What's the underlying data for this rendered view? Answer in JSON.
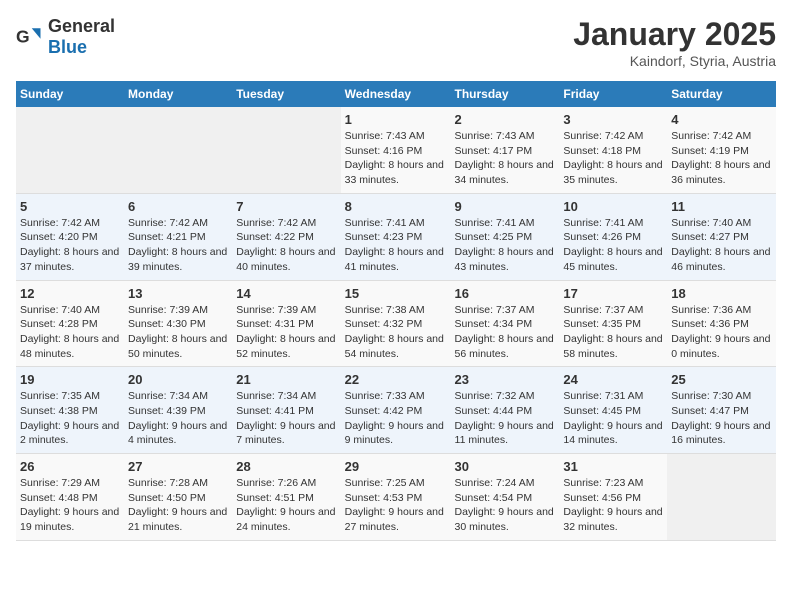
{
  "header": {
    "logo_general": "General",
    "logo_blue": "Blue",
    "title": "January 2025",
    "subtitle": "Kaindorf, Styria, Austria"
  },
  "weekdays": [
    "Sunday",
    "Monday",
    "Tuesday",
    "Wednesday",
    "Thursday",
    "Friday",
    "Saturday"
  ],
  "weeks": [
    [
      {
        "day": "",
        "info": ""
      },
      {
        "day": "",
        "info": ""
      },
      {
        "day": "",
        "info": ""
      },
      {
        "day": "1",
        "info": "Sunrise: 7:43 AM\nSunset: 4:16 PM\nDaylight: 8 hours and 33 minutes."
      },
      {
        "day": "2",
        "info": "Sunrise: 7:43 AM\nSunset: 4:17 PM\nDaylight: 8 hours and 34 minutes."
      },
      {
        "day": "3",
        "info": "Sunrise: 7:42 AM\nSunset: 4:18 PM\nDaylight: 8 hours and 35 minutes."
      },
      {
        "day": "4",
        "info": "Sunrise: 7:42 AM\nSunset: 4:19 PM\nDaylight: 8 hours and 36 minutes."
      }
    ],
    [
      {
        "day": "5",
        "info": "Sunrise: 7:42 AM\nSunset: 4:20 PM\nDaylight: 8 hours and 37 minutes."
      },
      {
        "day": "6",
        "info": "Sunrise: 7:42 AM\nSunset: 4:21 PM\nDaylight: 8 hours and 39 minutes."
      },
      {
        "day": "7",
        "info": "Sunrise: 7:42 AM\nSunset: 4:22 PM\nDaylight: 8 hours and 40 minutes."
      },
      {
        "day": "8",
        "info": "Sunrise: 7:41 AM\nSunset: 4:23 PM\nDaylight: 8 hours and 41 minutes."
      },
      {
        "day": "9",
        "info": "Sunrise: 7:41 AM\nSunset: 4:25 PM\nDaylight: 8 hours and 43 minutes."
      },
      {
        "day": "10",
        "info": "Sunrise: 7:41 AM\nSunset: 4:26 PM\nDaylight: 8 hours and 45 minutes."
      },
      {
        "day": "11",
        "info": "Sunrise: 7:40 AM\nSunset: 4:27 PM\nDaylight: 8 hours and 46 minutes."
      }
    ],
    [
      {
        "day": "12",
        "info": "Sunrise: 7:40 AM\nSunset: 4:28 PM\nDaylight: 8 hours and 48 minutes."
      },
      {
        "day": "13",
        "info": "Sunrise: 7:39 AM\nSunset: 4:30 PM\nDaylight: 8 hours and 50 minutes."
      },
      {
        "day": "14",
        "info": "Sunrise: 7:39 AM\nSunset: 4:31 PM\nDaylight: 8 hours and 52 minutes."
      },
      {
        "day": "15",
        "info": "Sunrise: 7:38 AM\nSunset: 4:32 PM\nDaylight: 8 hours and 54 minutes."
      },
      {
        "day": "16",
        "info": "Sunrise: 7:37 AM\nSunset: 4:34 PM\nDaylight: 8 hours and 56 minutes."
      },
      {
        "day": "17",
        "info": "Sunrise: 7:37 AM\nSunset: 4:35 PM\nDaylight: 8 hours and 58 minutes."
      },
      {
        "day": "18",
        "info": "Sunrise: 7:36 AM\nSunset: 4:36 PM\nDaylight: 9 hours and 0 minutes."
      }
    ],
    [
      {
        "day": "19",
        "info": "Sunrise: 7:35 AM\nSunset: 4:38 PM\nDaylight: 9 hours and 2 minutes."
      },
      {
        "day": "20",
        "info": "Sunrise: 7:34 AM\nSunset: 4:39 PM\nDaylight: 9 hours and 4 minutes."
      },
      {
        "day": "21",
        "info": "Sunrise: 7:34 AM\nSunset: 4:41 PM\nDaylight: 9 hours and 7 minutes."
      },
      {
        "day": "22",
        "info": "Sunrise: 7:33 AM\nSunset: 4:42 PM\nDaylight: 9 hours and 9 minutes."
      },
      {
        "day": "23",
        "info": "Sunrise: 7:32 AM\nSunset: 4:44 PM\nDaylight: 9 hours and 11 minutes."
      },
      {
        "day": "24",
        "info": "Sunrise: 7:31 AM\nSunset: 4:45 PM\nDaylight: 9 hours and 14 minutes."
      },
      {
        "day": "25",
        "info": "Sunrise: 7:30 AM\nSunset: 4:47 PM\nDaylight: 9 hours and 16 minutes."
      }
    ],
    [
      {
        "day": "26",
        "info": "Sunrise: 7:29 AM\nSunset: 4:48 PM\nDaylight: 9 hours and 19 minutes."
      },
      {
        "day": "27",
        "info": "Sunrise: 7:28 AM\nSunset: 4:50 PM\nDaylight: 9 hours and 21 minutes."
      },
      {
        "day": "28",
        "info": "Sunrise: 7:26 AM\nSunset: 4:51 PM\nDaylight: 9 hours and 24 minutes."
      },
      {
        "day": "29",
        "info": "Sunrise: 7:25 AM\nSunset: 4:53 PM\nDaylight: 9 hours and 27 minutes."
      },
      {
        "day": "30",
        "info": "Sunrise: 7:24 AM\nSunset: 4:54 PM\nDaylight: 9 hours and 30 minutes."
      },
      {
        "day": "31",
        "info": "Sunrise: 7:23 AM\nSunset: 4:56 PM\nDaylight: 9 hours and 32 minutes."
      },
      {
        "day": "",
        "info": ""
      }
    ]
  ]
}
